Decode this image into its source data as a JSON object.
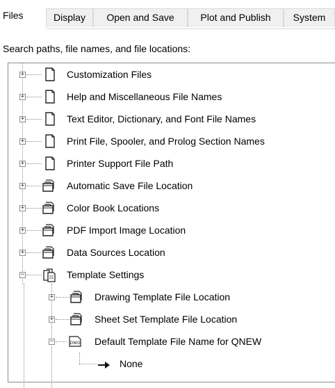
{
  "tabs": [
    {
      "label": "Files"
    },
    {
      "label": "Display"
    },
    {
      "label": "Open and Save"
    },
    {
      "label": "Plot and Publish"
    },
    {
      "label": "System"
    }
  ],
  "section_label": "Search paths, file names, and file locations:",
  "tree": {
    "items": [
      {
        "label": "Customization Files",
        "icon": "document-icon",
        "expander": "+"
      },
      {
        "label": "Help and Miscellaneous File Names",
        "icon": "document-icon",
        "expander": "+"
      },
      {
        "label": "Text Editor, Dictionary, and Font File Names",
        "icon": "document-icon",
        "expander": "+"
      },
      {
        "label": "Print File, Spooler, and Prolog Section Names",
        "icon": "document-icon",
        "expander": "+"
      },
      {
        "label": "Printer Support File Path",
        "icon": "document-icon",
        "expander": "+"
      },
      {
        "label": "Automatic Save File Location",
        "icon": "folder-stack-icon",
        "expander": "+"
      },
      {
        "label": "Color Book Locations",
        "icon": "folder-stack-icon",
        "expander": "+"
      },
      {
        "label": "PDF Import Image Location",
        "icon": "folder-stack-icon",
        "expander": "+"
      },
      {
        "label": "Data Sources Location",
        "icon": "folder-stack-icon",
        "expander": "+"
      },
      {
        "label": "Template Settings",
        "icon": "template-settings-icon",
        "expander": "-"
      },
      {
        "label": "Drawing Template File Location",
        "icon": "folder-stack-icon",
        "expander": "+"
      },
      {
        "label": "Sheet Set Template File Location",
        "icon": "folder-stack-icon",
        "expander": "+"
      },
      {
        "label": "Default Template File Name for QNEW",
        "icon": "dwg-file-icon",
        "expander": "-",
        "icon_text": "DWG"
      },
      {
        "label": "None",
        "icon": "arrow-right-icon"
      }
    ]
  }
}
